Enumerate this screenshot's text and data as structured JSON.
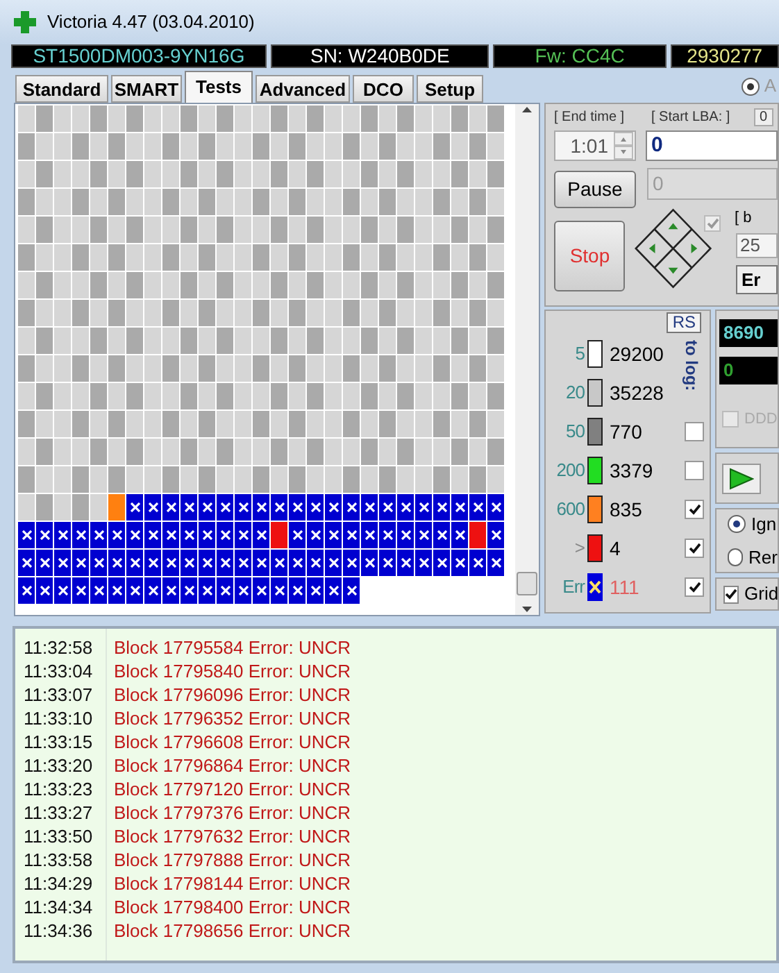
{
  "window": {
    "title": "Victoria 4.47 (03.04.2010)"
  },
  "drive_info": [
    {
      "text": "ST1500DM003-9YN16G"
    },
    {
      "text": "SN: W240B0DE"
    },
    {
      "text": "Fw: CC4C"
    },
    {
      "text": "2930277"
    }
  ],
  "tabs": [
    {
      "label": "Standard",
      "selected": false
    },
    {
      "label": "SMART",
      "selected": false
    },
    {
      "label": "Tests",
      "selected": true
    },
    {
      "label": "Advanced",
      "selected": false
    },
    {
      "label": "DCO",
      "selected": false
    },
    {
      "label": "Setup",
      "selected": false
    }
  ],
  "mode_radio": {
    "label": "A",
    "selected": true
  },
  "block_map": {
    "rows": [
      {
        "cells": [
          {
            "kind": "fast"
          },
          {
            "kind": "normal"
          },
          {
            "kind": "fast"
          },
          {
            "kind": "fast"
          },
          {
            "kind": "normal"
          },
          {
            "kind": "fast"
          },
          {
            "kind": "normal"
          },
          {
            "kind": "fast"
          },
          {
            "kind": "fast"
          },
          {
            "kind": "normal"
          },
          {
            "kind": "fast"
          },
          {
            "kind": "normal"
          },
          {
            "kind": "fast"
          },
          {
            "kind": "fast"
          },
          {
            "kind": "normal"
          },
          {
            "kind": "fast"
          },
          {
            "kind": "normal"
          },
          {
            "kind": "fast"
          },
          {
            "kind": "fast"
          },
          {
            "kind": "normal"
          },
          {
            "kind": "fast"
          },
          {
            "kind": "normal"
          },
          {
            "kind": "fast"
          },
          {
            "kind": "fast"
          },
          {
            "kind": "normal"
          },
          {
            "kind": "fast"
          },
          {
            "kind": "normal"
          }
        ]
      },
      {
        "cells": [
          {
            "kind": "normal"
          },
          {
            "kind": "fast"
          },
          {
            "kind": "fast"
          },
          {
            "kind": "normal"
          },
          {
            "kind": "fast"
          },
          {
            "kind": "normal"
          },
          {
            "kind": "fast"
          },
          {
            "kind": "fast"
          },
          {
            "kind": "normal"
          },
          {
            "kind": "fast"
          },
          {
            "kind": "normal"
          },
          {
            "kind": "fast"
          },
          {
            "kind": "fast"
          },
          {
            "kind": "normal"
          },
          {
            "kind": "fast"
          },
          {
            "kind": "normal"
          },
          {
            "kind": "fast"
          },
          {
            "kind": "fast"
          },
          {
            "kind": "normal"
          },
          {
            "kind": "fast"
          },
          {
            "kind": "normal"
          },
          {
            "kind": "fast"
          },
          {
            "kind": "fast"
          },
          {
            "kind": "normal"
          },
          {
            "kind": "fast"
          },
          {
            "kind": "normal"
          },
          {
            "kind": "fast"
          }
        ]
      },
      {
        "cells": [
          {
            "kind": "fast"
          },
          {
            "kind": "normal"
          },
          {
            "kind": "fast"
          },
          {
            "kind": "fast"
          },
          {
            "kind": "normal"
          },
          {
            "kind": "fast"
          },
          {
            "kind": "normal"
          },
          {
            "kind": "fast"
          },
          {
            "kind": "fast"
          },
          {
            "kind": "normal"
          },
          {
            "kind": "fast"
          },
          {
            "kind": "normal"
          },
          {
            "kind": "fast"
          },
          {
            "kind": "fast"
          },
          {
            "kind": "normal"
          },
          {
            "kind": "fast"
          },
          {
            "kind": "normal"
          },
          {
            "kind": "fast"
          },
          {
            "kind": "fast"
          },
          {
            "kind": "normal"
          },
          {
            "kind": "fast"
          },
          {
            "kind": "normal"
          },
          {
            "kind": "fast"
          },
          {
            "kind": "fast"
          },
          {
            "kind": "normal"
          },
          {
            "kind": "fast"
          },
          {
            "kind": "normal"
          }
        ]
      },
      {
        "cells": [
          {
            "kind": "normal"
          },
          {
            "kind": "fast"
          },
          {
            "kind": "fast"
          },
          {
            "kind": "normal"
          },
          {
            "kind": "fast"
          },
          {
            "kind": "normal"
          },
          {
            "kind": "fast"
          },
          {
            "kind": "fast"
          },
          {
            "kind": "normal"
          },
          {
            "kind": "fast"
          },
          {
            "kind": "normal"
          },
          {
            "kind": "fast"
          },
          {
            "kind": "fast"
          },
          {
            "kind": "normal"
          },
          {
            "kind": "fast"
          },
          {
            "kind": "normal"
          },
          {
            "kind": "fast"
          },
          {
            "kind": "fast"
          },
          {
            "kind": "normal"
          },
          {
            "kind": "fast"
          },
          {
            "kind": "normal"
          },
          {
            "kind": "fast"
          },
          {
            "kind": "fast"
          },
          {
            "kind": "normal"
          },
          {
            "kind": "fast"
          },
          {
            "kind": "normal"
          },
          {
            "kind": "fast"
          }
        ]
      },
      {
        "cells": [
          {
            "kind": "fast"
          },
          {
            "kind": "normal"
          },
          {
            "kind": "fast"
          },
          {
            "kind": "fast"
          },
          {
            "kind": "normal"
          },
          {
            "kind": "fast"
          },
          {
            "kind": "normal"
          },
          {
            "kind": "fast"
          },
          {
            "kind": "fast"
          },
          {
            "kind": "normal"
          },
          {
            "kind": "fast"
          },
          {
            "kind": "normal"
          },
          {
            "kind": "fast"
          },
          {
            "kind": "fast"
          },
          {
            "kind": "normal"
          },
          {
            "kind": "fast"
          },
          {
            "kind": "normal"
          },
          {
            "kind": "fast"
          },
          {
            "kind": "fast"
          },
          {
            "kind": "normal"
          },
          {
            "kind": "fast"
          },
          {
            "kind": "normal"
          },
          {
            "kind": "fast"
          },
          {
            "kind": "fast"
          },
          {
            "kind": "normal"
          },
          {
            "kind": "fast"
          },
          {
            "kind": "normal"
          }
        ]
      },
      {
        "cells": [
          {
            "kind": "normal"
          },
          {
            "kind": "fast"
          },
          {
            "kind": "fast"
          },
          {
            "kind": "normal"
          },
          {
            "kind": "fast"
          },
          {
            "kind": "normal"
          },
          {
            "kind": "fast"
          },
          {
            "kind": "fast"
          },
          {
            "kind": "normal"
          },
          {
            "kind": "fast"
          },
          {
            "kind": "normal"
          },
          {
            "kind": "fast"
          },
          {
            "kind": "fast"
          },
          {
            "kind": "normal"
          },
          {
            "kind": "fast"
          },
          {
            "kind": "normal"
          },
          {
            "kind": "fast"
          },
          {
            "kind": "fast"
          },
          {
            "kind": "normal"
          },
          {
            "kind": "fast"
          },
          {
            "kind": "normal"
          },
          {
            "kind": "fast"
          },
          {
            "kind": "fast"
          },
          {
            "kind": "normal"
          },
          {
            "kind": "fast"
          },
          {
            "kind": "normal"
          },
          {
            "kind": "fast"
          }
        ]
      },
      {
        "cells": [
          {
            "kind": "fast"
          },
          {
            "kind": "normal"
          },
          {
            "kind": "fast"
          },
          {
            "kind": "fast"
          },
          {
            "kind": "normal"
          },
          {
            "kind": "fast"
          },
          {
            "kind": "normal"
          },
          {
            "kind": "fast"
          },
          {
            "kind": "fast"
          },
          {
            "kind": "normal"
          },
          {
            "kind": "fast"
          },
          {
            "kind": "normal"
          },
          {
            "kind": "fast"
          },
          {
            "kind": "fast"
          },
          {
            "kind": "normal"
          },
          {
            "kind": "fast"
          },
          {
            "kind": "normal"
          },
          {
            "kind": "fast"
          },
          {
            "kind": "fast"
          },
          {
            "kind": "normal"
          },
          {
            "kind": "fast"
          },
          {
            "kind": "normal"
          },
          {
            "kind": "fast"
          },
          {
            "kind": "fast"
          },
          {
            "kind": "normal"
          },
          {
            "kind": "fast"
          },
          {
            "kind": "normal"
          }
        ]
      },
      {
        "cells": [
          {
            "kind": "normal"
          },
          {
            "kind": "fast"
          },
          {
            "kind": "fast"
          },
          {
            "kind": "normal"
          },
          {
            "kind": "fast"
          },
          {
            "kind": "normal"
          },
          {
            "kind": "fast"
          },
          {
            "kind": "fast"
          },
          {
            "kind": "normal"
          },
          {
            "kind": "fast"
          },
          {
            "kind": "normal"
          },
          {
            "kind": "fast"
          },
          {
            "kind": "fast"
          },
          {
            "kind": "normal"
          },
          {
            "kind": "fast"
          },
          {
            "kind": "normal"
          },
          {
            "kind": "fast"
          },
          {
            "kind": "fast"
          },
          {
            "kind": "normal"
          },
          {
            "kind": "fast"
          },
          {
            "kind": "normal"
          },
          {
            "kind": "fast"
          },
          {
            "kind": "fast"
          },
          {
            "kind": "normal"
          },
          {
            "kind": "fast"
          },
          {
            "kind": "normal"
          },
          {
            "kind": "fast"
          }
        ]
      },
      {
        "cells": [
          {
            "kind": "fast"
          },
          {
            "kind": "normal"
          },
          {
            "kind": "fast"
          },
          {
            "kind": "fast"
          },
          {
            "kind": "normal"
          },
          {
            "kind": "fast"
          },
          {
            "kind": "normal"
          },
          {
            "kind": "fast"
          },
          {
            "kind": "fast"
          },
          {
            "kind": "normal"
          },
          {
            "kind": "fast"
          },
          {
            "kind": "normal"
          },
          {
            "kind": "fast"
          },
          {
            "kind": "fast"
          },
          {
            "kind": "normal"
          },
          {
            "kind": "fast"
          },
          {
            "kind": "normal"
          },
          {
            "kind": "fast"
          },
          {
            "kind": "fast"
          },
          {
            "kind": "normal"
          },
          {
            "kind": "fast"
          },
          {
            "kind": "normal"
          },
          {
            "kind": "fast"
          },
          {
            "kind": "fast"
          },
          {
            "kind": "normal"
          },
          {
            "kind": "fast"
          },
          {
            "kind": "normal"
          }
        ]
      },
      {
        "cells": [
          {
            "kind": "normal"
          },
          {
            "kind": "fast"
          },
          {
            "kind": "fast"
          },
          {
            "kind": "normal"
          },
          {
            "kind": "fast"
          },
          {
            "kind": "normal"
          },
          {
            "kind": "fast"
          },
          {
            "kind": "fast"
          },
          {
            "kind": "normal"
          },
          {
            "kind": "fast"
          },
          {
            "kind": "normal"
          },
          {
            "kind": "fast"
          },
          {
            "kind": "fast"
          },
          {
            "kind": "normal"
          },
          {
            "kind": "fast"
          },
          {
            "kind": "normal"
          },
          {
            "kind": "fast"
          },
          {
            "kind": "fast"
          },
          {
            "kind": "normal"
          },
          {
            "kind": "fast"
          },
          {
            "kind": "normal"
          },
          {
            "kind": "fast"
          },
          {
            "kind": "fast"
          },
          {
            "kind": "normal"
          },
          {
            "kind": "fast"
          },
          {
            "kind": "normal"
          },
          {
            "kind": "fast"
          }
        ]
      },
      {
        "cells": [
          {
            "kind": "fast"
          },
          {
            "kind": "normal"
          },
          {
            "kind": "fast"
          },
          {
            "kind": "fast"
          },
          {
            "kind": "normal"
          },
          {
            "kind": "fast"
          },
          {
            "kind": "normal"
          },
          {
            "kind": "fast"
          },
          {
            "kind": "fast"
          },
          {
            "kind": "normal"
          },
          {
            "kind": "fast"
          },
          {
            "kind": "normal"
          },
          {
            "kind": "fast"
          },
          {
            "kind": "fast"
          },
          {
            "kind": "normal"
          },
          {
            "kind": "fast"
          },
          {
            "kind": "normal"
          },
          {
            "kind": "fast"
          },
          {
            "kind": "fast"
          },
          {
            "kind": "normal"
          },
          {
            "kind": "fast"
          },
          {
            "kind": "normal"
          },
          {
            "kind": "fast"
          },
          {
            "kind": "fast"
          },
          {
            "kind": "normal"
          },
          {
            "kind": "fast"
          },
          {
            "kind": "normal"
          }
        ]
      },
      {
        "cells": [
          {
            "kind": "normal"
          },
          {
            "kind": "fast"
          },
          {
            "kind": "fast"
          },
          {
            "kind": "normal"
          },
          {
            "kind": "fast"
          },
          {
            "kind": "normal"
          },
          {
            "kind": "fast"
          },
          {
            "kind": "fast"
          },
          {
            "kind": "normal"
          },
          {
            "kind": "fast"
          },
          {
            "kind": "normal"
          },
          {
            "kind": "fast"
          },
          {
            "kind": "fast"
          },
          {
            "kind": "normal"
          },
          {
            "kind": "fast"
          },
          {
            "kind": "normal"
          },
          {
            "kind": "fast"
          },
          {
            "kind": "fast"
          },
          {
            "kind": "normal"
          },
          {
            "kind": "fast"
          },
          {
            "kind": "normal"
          },
          {
            "kind": "fast"
          },
          {
            "kind": "fast"
          },
          {
            "kind": "normal"
          },
          {
            "kind": "fast"
          },
          {
            "kind": "normal"
          },
          {
            "kind": "fast"
          }
        ]
      },
      {
        "cells": [
          {
            "kind": "fast"
          },
          {
            "kind": "normal"
          },
          {
            "kind": "fast"
          },
          {
            "kind": "fast"
          },
          {
            "kind": "normal"
          },
          {
            "kind": "fast"
          },
          {
            "kind": "normal"
          },
          {
            "kind": "fast"
          },
          {
            "kind": "fast"
          },
          {
            "kind": "normal"
          },
          {
            "kind": "fast"
          },
          {
            "kind": "normal"
          },
          {
            "kind": "fast"
          },
          {
            "kind": "fast"
          },
          {
            "kind": "normal"
          },
          {
            "kind": "fast"
          },
          {
            "kind": "normal"
          },
          {
            "kind": "fast"
          },
          {
            "kind": "fast"
          },
          {
            "kind": "normal"
          },
          {
            "kind": "fast"
          },
          {
            "kind": "normal"
          },
          {
            "kind": "fast"
          },
          {
            "kind": "fast"
          },
          {
            "kind": "normal"
          },
          {
            "kind": "fast"
          },
          {
            "kind": "normal"
          }
        ]
      },
      {
        "cells": [
          {
            "kind": "normal"
          },
          {
            "kind": "fast"
          },
          {
            "kind": "fast"
          },
          {
            "kind": "normal"
          },
          {
            "kind": "fast"
          },
          {
            "kind": "normal"
          },
          {
            "kind": "fast"
          },
          {
            "kind": "fast"
          },
          {
            "kind": "normal"
          },
          {
            "kind": "fast"
          },
          {
            "kind": "normal"
          },
          {
            "kind": "fast"
          },
          {
            "kind": "fast"
          },
          {
            "kind": "normal"
          },
          {
            "kind": "fast"
          },
          {
            "kind": "normal"
          },
          {
            "kind": "fast"
          },
          {
            "kind": "fast"
          },
          {
            "kind": "normal"
          },
          {
            "kind": "fast"
          },
          {
            "kind": "normal"
          },
          {
            "kind": "fast"
          },
          {
            "kind": "fast"
          },
          {
            "kind": "normal"
          },
          {
            "kind": "fast"
          },
          {
            "kind": "normal"
          },
          {
            "kind": "fast"
          }
        ]
      },
      {
        "cells": [
          {
            "kind": "fast"
          },
          {
            "kind": "normal"
          },
          {
            "kind": "fast"
          },
          {
            "kind": "normal"
          },
          {
            "kind": "fast"
          },
          {
            "kind": "slow"
          },
          {
            "kind": "error"
          },
          {
            "kind": "error"
          },
          {
            "kind": "error"
          },
          {
            "kind": "error"
          },
          {
            "kind": "error"
          },
          {
            "kind": "error"
          },
          {
            "kind": "error"
          },
          {
            "kind": "error"
          },
          {
            "kind": "error"
          },
          {
            "kind": "error"
          },
          {
            "kind": "error"
          },
          {
            "kind": "error"
          },
          {
            "kind": "error"
          },
          {
            "kind": "error"
          },
          {
            "kind": "error"
          },
          {
            "kind": "error"
          },
          {
            "kind": "error"
          },
          {
            "kind": "error"
          },
          {
            "kind": "error"
          },
          {
            "kind": "error"
          },
          {
            "kind": "error"
          }
        ]
      },
      {
        "cells": [
          {
            "kind": "error"
          },
          {
            "kind": "error"
          },
          {
            "kind": "error"
          },
          {
            "kind": "error"
          },
          {
            "kind": "error"
          },
          {
            "kind": "error"
          },
          {
            "kind": "error"
          },
          {
            "kind": "error"
          },
          {
            "kind": "error"
          },
          {
            "kind": "error"
          },
          {
            "kind": "error"
          },
          {
            "kind": "error"
          },
          {
            "kind": "error"
          },
          {
            "kind": "error"
          },
          {
            "kind": "bad"
          },
          {
            "kind": "error"
          },
          {
            "kind": "error"
          },
          {
            "kind": "error"
          },
          {
            "kind": "error"
          },
          {
            "kind": "error"
          },
          {
            "kind": "error"
          },
          {
            "kind": "error"
          },
          {
            "kind": "error"
          },
          {
            "kind": "error"
          },
          {
            "kind": "error"
          },
          {
            "kind": "bad"
          },
          {
            "kind": "error"
          }
        ]
      },
      {
        "cells": [
          {
            "kind": "error"
          },
          {
            "kind": "error"
          },
          {
            "kind": "error"
          },
          {
            "kind": "error"
          },
          {
            "kind": "error"
          },
          {
            "kind": "error"
          },
          {
            "kind": "error"
          },
          {
            "kind": "error"
          },
          {
            "kind": "error"
          },
          {
            "kind": "error"
          },
          {
            "kind": "error"
          },
          {
            "kind": "error"
          },
          {
            "kind": "error"
          },
          {
            "kind": "error"
          },
          {
            "kind": "error"
          },
          {
            "kind": "error"
          },
          {
            "kind": "error"
          },
          {
            "kind": "error"
          },
          {
            "kind": "error"
          },
          {
            "kind": "error"
          },
          {
            "kind": "error"
          },
          {
            "kind": "error"
          },
          {
            "kind": "error"
          },
          {
            "kind": "error"
          },
          {
            "kind": "error"
          },
          {
            "kind": "error"
          },
          {
            "kind": "error"
          }
        ]
      },
      {
        "cells": [
          {
            "kind": "error"
          },
          {
            "kind": "error"
          },
          {
            "kind": "error"
          },
          {
            "kind": "error"
          },
          {
            "kind": "error"
          },
          {
            "kind": "error"
          },
          {
            "kind": "error"
          },
          {
            "kind": "error"
          },
          {
            "kind": "error"
          },
          {
            "kind": "error"
          },
          {
            "kind": "error"
          },
          {
            "kind": "error"
          },
          {
            "kind": "error"
          },
          {
            "kind": "error"
          },
          {
            "kind": "error"
          },
          {
            "kind": "error"
          },
          {
            "kind": "error"
          },
          {
            "kind": "error"
          },
          {
            "kind": "error"
          }
        ]
      }
    ]
  },
  "controls": {
    "end_time_label": "[ End time ]",
    "start_lba_label": "[ Start LBA: ]",
    "lba_box": "0",
    "end_time": "1:01",
    "start_lba": "0",
    "pause": "Pause",
    "end_lba": "0",
    "stop": "Stop",
    "option_checked": true,
    "block_label": "[ b",
    "block_size": "25",
    "button_3": "Er"
  },
  "legend": {
    "reset": "RS",
    "to_log": "to log:",
    "rows": [
      {
        "threshold": "5",
        "count": "29200",
        "kind": "block",
        "color": "#ffffff"
      },
      {
        "threshold": "20",
        "count": "35228",
        "kind": "block",
        "color": "#c8c8c8"
      },
      {
        "threshold": "50",
        "count": "770",
        "kind": "block",
        "color": "#808080",
        "checked": false
      },
      {
        "threshold": "200",
        "count": "3379",
        "kind": "block",
        "color": "#22dd22",
        "checked": false
      },
      {
        "threshold": "600",
        "count": "835",
        "kind": "block",
        "color": "#ff8020",
        "checked": true
      },
      {
        "threshold": ">",
        "count": "4",
        "kind": "block",
        "color": "#ee1111",
        "checked": true
      },
      {
        "threshold": "Err",
        "count": "111",
        "kind": "error",
        "color": "#0000dd",
        "checked": true
      }
    ]
  },
  "side": {
    "speed": "8690",
    "value_2": "0",
    "ddd": {
      "label": "DDD",
      "checked": false
    },
    "actions": [
      {
        "label": "Ign",
        "selected": true
      },
      {
        "label": "Rer",
        "selected": false
      }
    ],
    "grid": {
      "label": "Grid",
      "checked": true
    }
  },
  "log": [
    {
      "time": "11:32:58",
      "message": "Block 17795584 Error: UNCR"
    },
    {
      "time": "11:33:04",
      "message": "Block 17795840 Error: UNCR"
    },
    {
      "time": "11:33:07",
      "message": "Block 17796096 Error: UNCR"
    },
    {
      "time": "11:33:10",
      "message": "Block 17796352 Error: UNCR"
    },
    {
      "time": "11:33:15",
      "message": "Block 17796608 Error: UNCR"
    },
    {
      "time": "11:33:20",
      "message": "Block 17796864 Error: UNCR"
    },
    {
      "time": "11:33:23",
      "message": "Block 17797120 Error: UNCR"
    },
    {
      "time": "11:33:27",
      "message": "Block 17797376 Error: UNCR"
    },
    {
      "time": "11:33:50",
      "message": "Block 17797632 Error: UNCR"
    },
    {
      "time": "11:33:58",
      "message": "Block 17797888 Error: UNCR"
    },
    {
      "time": "11:34:29",
      "message": "Block 17798144 Error: UNCR"
    },
    {
      "time": "11:34:34",
      "message": "Block 17798400 Error: UNCR"
    },
    {
      "time": "11:34:36",
      "message": "Block 17798656 Error: UNCR"
    }
  ]
}
